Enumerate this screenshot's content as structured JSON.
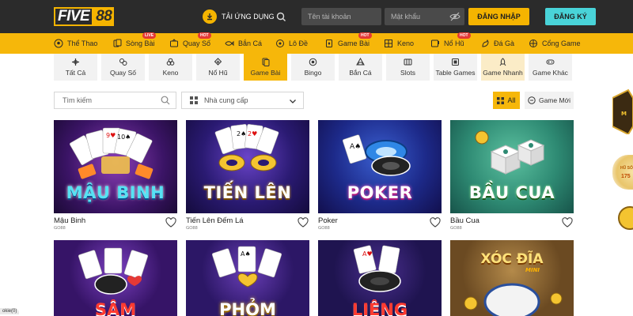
{
  "header": {
    "logo_text_1": "FIVE",
    "logo_text_2": "88",
    "app_label": "TẢI ỨNG DỤNG",
    "username_placeholder": "Tên tài khoản",
    "password_placeholder": "Mật khẩu",
    "login_label": "ĐĂNG NHẬP",
    "register_label": "ĐĂNG KÝ",
    "colors": {
      "bg": "#2b2b2b",
      "accent": "#f5b400",
      "register": "#49d3d8"
    }
  },
  "nav": {
    "items": [
      {
        "label": "Thể Thao",
        "icon": "soccer-ball-icon",
        "badge": ""
      },
      {
        "label": "Sòng Bài",
        "icon": "cards-icon",
        "badge": "LIVE"
      },
      {
        "label": "Quay Số",
        "icon": "lottery-icon",
        "badge": "HOT"
      },
      {
        "label": "Bắn Cá",
        "icon": "fish-icon",
        "badge": ""
      },
      {
        "label": "Lô Đề",
        "icon": "lotto-icon",
        "badge": ""
      },
      {
        "label": "Game Bài",
        "icon": "card-game-icon",
        "badge": "HOT"
      },
      {
        "label": "Keno",
        "icon": "keno-icon",
        "badge": ""
      },
      {
        "label": "Nổ Hũ",
        "icon": "slot-icon",
        "badge": "HOT"
      },
      {
        "label": "Đá Gà",
        "icon": "rooster-icon",
        "badge": ""
      },
      {
        "label": "Cổng Game",
        "icon": "gamepad-icon",
        "badge": ""
      }
    ]
  },
  "categories": [
    {
      "label": "Tất Cả",
      "icon": "grid-icon"
    },
    {
      "label": "Quay Số",
      "icon": "balls-icon"
    },
    {
      "label": "Keno",
      "icon": "keno-balls-icon"
    },
    {
      "label": "Nổ Hũ",
      "icon": "slot-icon"
    },
    {
      "label": "Game Bài",
      "icon": "card-game-icon"
    },
    {
      "label": "Bingo",
      "icon": "bingo-icon"
    },
    {
      "label": "Bắn Cá",
      "icon": "fish-icon"
    },
    {
      "label": "Slots",
      "icon": "slots-machine-icon"
    },
    {
      "label": "Table Games",
      "icon": "table-icon"
    },
    {
      "label": "Game Nhanh",
      "icon": "rocket-icon"
    },
    {
      "label": "Game Khác",
      "icon": "gamepad-icon"
    }
  ],
  "filters": {
    "search_placeholder": "Tìm kiếm",
    "provider_label": "Nhà cung cấp",
    "all_label": "All",
    "new_label": "Game Mới"
  },
  "games": [
    {
      "name": "Mậu Binh",
      "provider": "GO88",
      "art_title": "MẬU BINH"
    },
    {
      "name": "Tiến Lên Đếm Lá",
      "provider": "GO88",
      "art_title": "TIẾN LÊN"
    },
    {
      "name": "Poker",
      "provider": "GO88",
      "art_title": "POKER"
    },
    {
      "name": "Bầu Cua",
      "provider": "GO88",
      "art_title": "BẦU CUA"
    }
  ],
  "games_row2": [
    {
      "art_title": "SÂM"
    },
    {
      "art_title": "PHỎM"
    },
    {
      "art_title": "LIÊNG"
    },
    {
      "art_title": "XÓC ĐĨA",
      "art_sub": "MINI"
    }
  ],
  "side_promo": {
    "text_1": "HŨ SỐ",
    "text_2": "175"
  },
  "cookie_text": "okie(0)"
}
